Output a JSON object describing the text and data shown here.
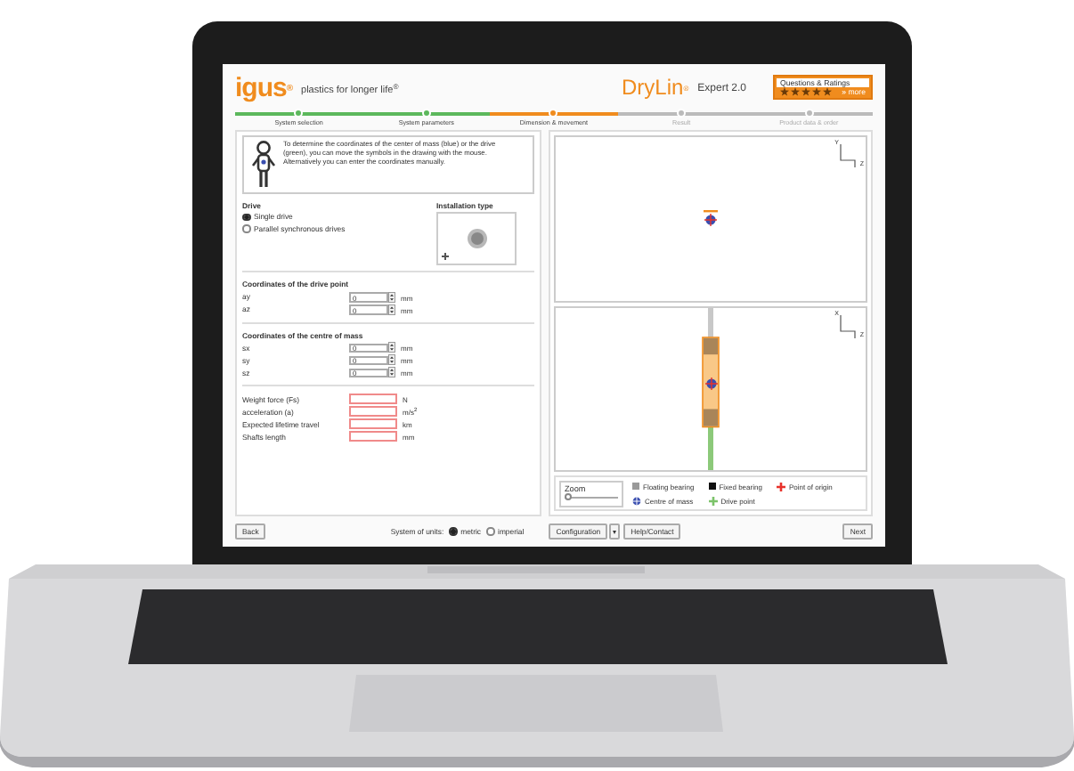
{
  "header": {
    "logo": "igus$^{®}$",
    "tagline": "plastics for longer life$^{®}$",
    "product": "DryLin$^{®}$",
    "product_version": "Expert 2.0",
    "ratings": {
      "title": "Questions & Ratings",
      "stars": 5,
      "link": "» more"
    }
  },
  "steps": [
    {
      "label": "System selection",
      "completed": true,
      "selected": false
    },
    {
      "label": "System parameters",
      "completed": true,
      "selected": false
    },
    {
      "label": "Dimension & movement",
      "completed": false,
      "selected": true
    },
    {
      "label": "Result",
      "completed": false,
      "selected": false
    },
    {
      "label": "Product data & order",
      "completed": false,
      "selected": false
    }
  ],
  "hint": "To determine the coordinates of the center of mass (blue) or the drive (green), you can move the symbols in the drawing with the mouse. Alternatively you can enter the coordinates manually.",
  "drive": {
    "title": "Drive",
    "options": [
      {
        "label": "Single drive",
        "selected": true
      },
      {
        "label": "Parallel synchronous drives",
        "selected": false
      }
    ]
  },
  "installation_type": {
    "title": "Installation type"
  },
  "sections": [
    {
      "title": "Coordinates of the drive point",
      "fields": [
        {
          "label": "ay",
          "value": "0",
          "unit": "mm",
          "kind": "spin"
        },
        {
          "label": "az",
          "value": "0",
          "unit": "mm",
          "kind": "spin"
        }
      ]
    },
    {
      "title": "Coordinates of the centre of mass",
      "fields": [
        {
          "label": "sx",
          "value": "0",
          "unit": "mm",
          "kind": "spin"
        },
        {
          "label": "sy",
          "value": "0",
          "unit": "mm",
          "kind": "spin"
        },
        {
          "label": "sz",
          "value": "0",
          "unit": "mm",
          "kind": "spin"
        }
      ]
    },
    {
      "fields": [
        {
          "label": "Weight force (Fs)",
          "unit": "N",
          "kind": "required"
        },
        {
          "label": "acceleration (a)",
          "unit": "m/s$^{2}$",
          "kind": "required"
        },
        {
          "label": "Expected lifetime travel",
          "unit": "km",
          "kind": "required"
        },
        {
          "label": "Shafts length",
          "unit": "mm",
          "kind": "required"
        }
      ]
    }
  ],
  "views": [
    {
      "axis_vertical": "Y",
      "axis_horizontal": "Z",
      "kind": "top"
    },
    {
      "axis_vertical": "X",
      "axis_horizontal": "Z",
      "kind": "side"
    }
  ],
  "zoom": {
    "label": "Zoom",
    "level": 0.05
  },
  "legend": [
    {
      "label": "Floating bearing",
      "kind": "square",
      "color": "#9a9a9a"
    },
    {
      "label": "Fixed bearing",
      "kind": "square",
      "color": "#111111"
    },
    {
      "label": "Point of origin",
      "kind": "plus",
      "color": "#e8322b"
    },
    {
      "label": "Centre of mass",
      "kind": "target",
      "color": "#3a4fb0"
    },
    {
      "label": "Drive point",
      "kind": "plus",
      "color": "#7cc36a"
    }
  ],
  "footer": {
    "back": "Back",
    "units_label": "System of units:",
    "units": [
      {
        "label": "metric",
        "selected": true
      },
      {
        "label": "imperial",
        "selected": false
      }
    ],
    "configuration": "Configuration",
    "dropdown": "▾",
    "help": "Help/Contact",
    "next": "Next"
  }
}
